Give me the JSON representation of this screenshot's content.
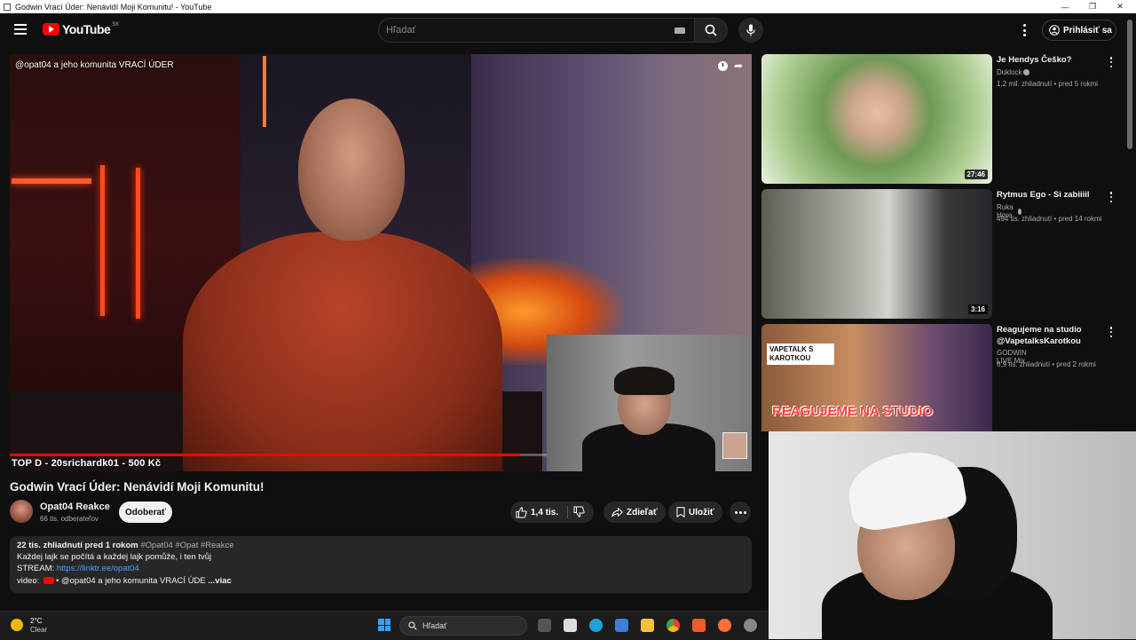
{
  "window": {
    "title": "Godwin Vrací Úder: Nenávidí Moji Komunitu! - YouTube"
  },
  "header": {
    "logo_text": "YouTube",
    "logo_country": "SK",
    "search_placeholder": "Hľadať",
    "signin_label": "Prihlásiť sa"
  },
  "player": {
    "overlay_title": "@opat04 a jeho komunita VRACÍ ÚDER",
    "top_donation": "TOP D -  20srichardk01 - 500 Kč",
    "progress_fraction": 0.95
  },
  "video": {
    "title": "Godwin Vrací Úder: Nenávidí Moji Komunitu!",
    "channel_name": "Opat04 Reakce",
    "subscribers": "66 tis. odberateľov",
    "subscribe_label": "Odoberať",
    "likes": "1,4 tis.",
    "share_label": "Zdieľať",
    "save_label": "Uložiť"
  },
  "description": {
    "stats": "22 tis. zhliadnutí  pred 1 rokom",
    "hashtags": "#Opat04 #Opat #Reakce",
    "line2": "Každej lajk se počítá a každej lajk pomůže, i ten tvůj",
    "stream_label": "STREAM: ",
    "stream_link": "https://linktr.ee/opat04",
    "video_label": "video: ",
    "video_text": "• @opat04  a jeho komunita VRACÍ ÚDE",
    "more_label": "...viac"
  },
  "recommendations": [
    {
      "title": "Je Hendys Češko?",
      "channel": "Duklock",
      "meta": "1,2 mil. zhliadnutí • pred 5 rokmi",
      "duration": "27:46"
    },
    {
      "title": "Rytmus  Ego - Si zabiiiil",
      "channel": "Ruka Hore",
      "meta": "494 tis. zhliadnutí • pred 14 rokmi",
      "duration": "3:16"
    },
    {
      "title": "Reagujeme na studio @VapetalksKarotkou",
      "channel": "GODWIN LIVE Mix",
      "meta": "6,9 tis. zhliadnutí • pred 2 rokmi",
      "thumb_text": "REAGUJEME NA STUDIO",
      "thumb_badge": "VAPETALK S KAROTKOU"
    }
  ],
  "taskbar": {
    "temperature": "2°C",
    "weather": "Clear",
    "search_placeholder": "Hľadať"
  },
  "colors": {
    "brand_red": "#ff0000",
    "background": "#0f0f0f",
    "link": "#3ea6ff"
  }
}
